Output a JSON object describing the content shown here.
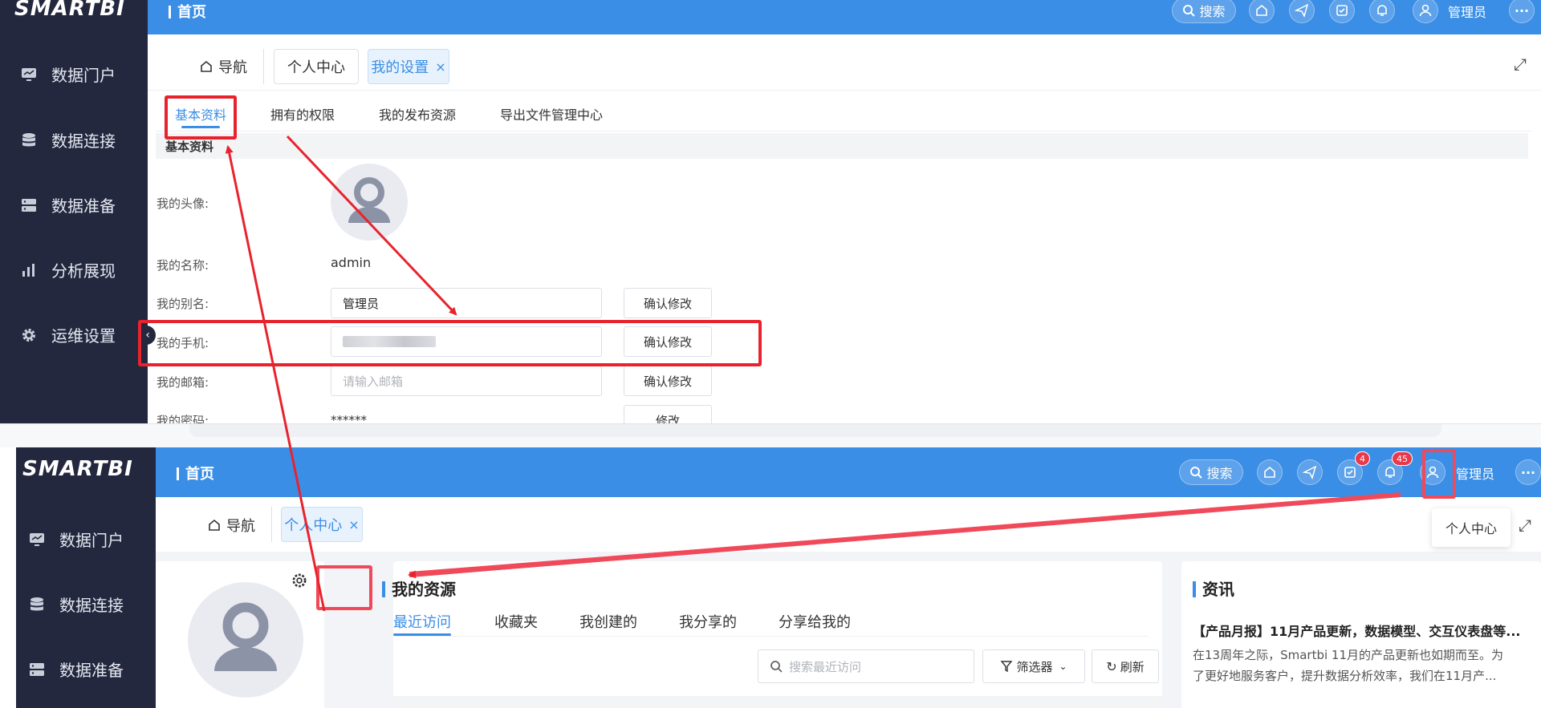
{
  "brand": "SMARTBI",
  "colors": {
    "sidebar": "#23283f",
    "topbar": "#3a8ee6",
    "accent": "#3a8ee6",
    "highlight": "#e8232d",
    "badge": "#e8394a"
  },
  "sidebar": {
    "items": [
      {
        "label": "数据门户",
        "icon": "monitor-icon"
      },
      {
        "label": "数据连接",
        "icon": "database-icon"
      },
      {
        "label": "数据准备",
        "icon": "server-icon"
      },
      {
        "label": "分析展现",
        "icon": "bar-chart-icon"
      },
      {
        "label": "运维设置",
        "icon": "gear-icon"
      }
    ]
  },
  "topbar": {
    "title": "首页",
    "search_label": "搜索",
    "user_label": "管理员",
    "tasks_badge": "4",
    "notify_badge": "45"
  },
  "top_shot": {
    "tabs": {
      "nav": "导航",
      "personal": "个人中心",
      "settings": "我的设置"
    },
    "subtabs": [
      "基本资料",
      "拥有的权限",
      "我的发布资源",
      "导出文件管理中心"
    ],
    "section_header": "基本资料",
    "form": {
      "avatar_label": "我的头像:",
      "name_label": "我的名称:",
      "name_value": "admin",
      "alias_label": "我的别名:",
      "alias_value": "管理员",
      "phone_label": "我的手机:",
      "email_label": "我的邮箱:",
      "email_placeholder": "请输入邮箱",
      "password_label": "我的密码:",
      "password_value": "******",
      "confirm_label": "确认修改",
      "modify_label": "修改"
    }
  },
  "bottom_shot": {
    "tabs": {
      "nav": "导航",
      "personal": "个人中心"
    },
    "dropdown_item": "个人中心",
    "resources": {
      "title": "我的资源",
      "tabs": [
        "最近访问",
        "收藏夹",
        "我创建的",
        "我分享的",
        "分享给我的"
      ],
      "search_placeholder": "搜索最近访问",
      "filter_label": "筛选器",
      "refresh_label": "刷新"
    },
    "news": {
      "title": "资讯",
      "headline": "【产品月报】11月产品更新，数据模型、交互仪表盘等...",
      "summary_line1": "在13周年之际，Smartbi 11月的产品更新也如期而至。为",
      "summary_line2": "了更好地服务客户，提升数据分析效率，我们在11月产..."
    }
  }
}
